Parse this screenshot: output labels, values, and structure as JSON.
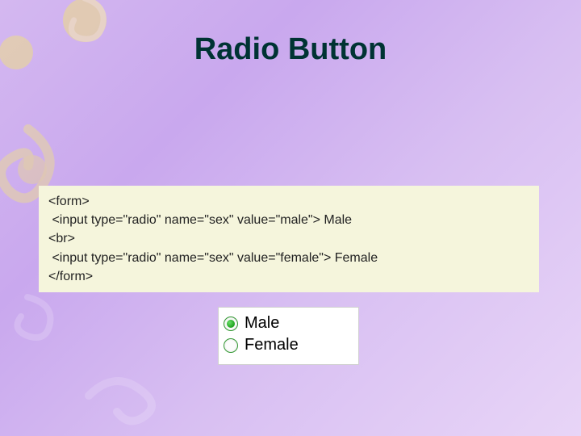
{
  "title": "Radio Button",
  "code": {
    "l1": "<form>",
    "l2": " <input type=\"radio\" name=\"sex\" value=\"male\"> Male",
    "l3": "<br>",
    "l4": " <input type=\"radio\" name=\"sex\" value=\"female\"> Female",
    "l5": "</form>"
  },
  "demo": {
    "option1": {
      "label": "Male",
      "checked": true
    },
    "option2": {
      "label": "Female",
      "checked": false
    }
  },
  "colors": {
    "background_accent": "#c9a8ee",
    "codebox_bg": "#f5f5dc",
    "title_color": "#003333",
    "radio_accent": "#008800"
  }
}
